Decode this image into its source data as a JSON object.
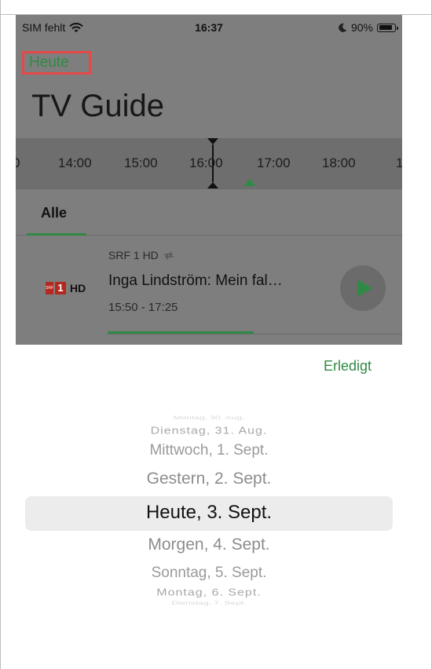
{
  "status_bar": {
    "carrier": "SIM fehlt",
    "time": "16:37",
    "battery": "90%",
    "battery_level": 0.9
  },
  "header": {
    "today_button": "Heute",
    "title": "TV Guide"
  },
  "timeline": {
    "ticks": [
      "0",
      "14:00",
      "15:00",
      "16:00",
      "17:00",
      "18:00",
      "1"
    ]
  },
  "filters": {
    "active_tab": "Alle"
  },
  "program": {
    "channel": "SRF 1 HD",
    "logo_srf": "SRF",
    "logo_number": "1",
    "logo_hd": "HD",
    "title": "Inga Lindström: Mein fal…",
    "time": "15:50 - 17:25",
    "progress": 0.5
  },
  "sheet": {
    "done_label": "Erledigt"
  },
  "date_picker": {
    "items": [
      "Montag, 30. Aug.",
      "Dienstag, 31. Aug.",
      "Mittwoch, 1. Sept.",
      "Gestern, 2. Sept.",
      "Heute, 3. Sept.",
      "Morgen, 4. Sept.",
      "Sonntag, 5. Sept.",
      "Montag, 6. Sept.",
      "Dienstag, 7. Sept."
    ],
    "selected": "Heute, 3. Sept."
  },
  "colors": {
    "accent": "#2f8a45",
    "highlight_border": "#e64848",
    "overlay": "#7e7e7e"
  }
}
